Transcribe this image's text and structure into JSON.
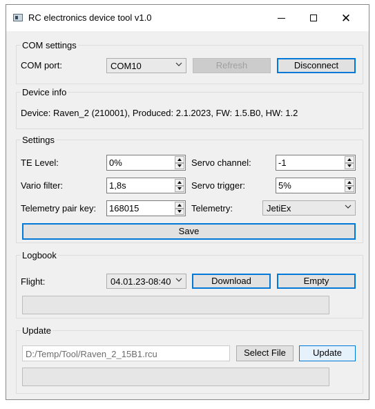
{
  "window": {
    "title": "RC electronics device tool v1.0"
  },
  "com_settings": {
    "title": "COM settings",
    "port_label": "COM port:",
    "port_value": "COM10",
    "refresh_label": "Refresh",
    "disconnect_label": "Disconnect"
  },
  "device_info": {
    "title": "Device info",
    "text": "Device: Raven_2 (210001), Produced: 2.1.2023, FW: 1.5.B0, HW: 1.2"
  },
  "settings": {
    "title": "Settings",
    "te_level_label": "TE Level:",
    "te_level_value": "0%",
    "vario_filter_label": "Vario filter:",
    "vario_filter_value": "1,8s",
    "pair_key_label": "Telemetry pair key:",
    "pair_key_value": "168015",
    "servo_channel_label": "Servo channel:",
    "servo_channel_value": "-1",
    "servo_trigger_label": "Servo trigger:",
    "servo_trigger_value": "5%",
    "telemetry_label": "Telemetry:",
    "telemetry_value": "JetiEx",
    "save_label": "Save"
  },
  "logbook": {
    "title": "Logbook",
    "flight_label": "Flight:",
    "flight_value": "04.01.23-08:40",
    "download_label": "Download",
    "empty_label": "Empty",
    "progress": 0
  },
  "update": {
    "title": "Update",
    "file_path": "D:/Temp/Tool/Raven_2_15B1.rcu",
    "select_file_label": "Select File",
    "update_label": "Update",
    "progress": 0
  }
}
